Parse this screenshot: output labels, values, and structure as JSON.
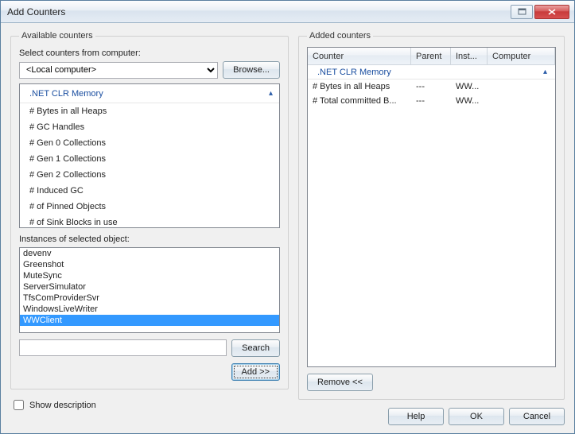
{
  "window": {
    "title": "Add Counters"
  },
  "available": {
    "legend": "Available counters",
    "select_label": "Select counters from computer:",
    "computer_value": "<Local computer>",
    "browse_label": "Browse...",
    "group_name": ".NET CLR Memory",
    "counters": [
      "# Bytes in all Heaps",
      "# GC Handles",
      "# Gen 0 Collections",
      "# Gen 1 Collections",
      "# Gen 2 Collections",
      "# Induced GC",
      "# of Pinned Objects",
      "# of Sink Blocks in use"
    ],
    "instances_label": "Instances of selected object:",
    "instances": [
      "devenv",
      "Greenshot",
      "MuteSync",
      "ServerSimulator",
      "TfsComProviderSvr",
      "WindowsLiveWriter",
      "WWClient"
    ],
    "search_label": "Search",
    "add_label": "Add >>",
    "show_desc_label": "Show description"
  },
  "added": {
    "legend": "Added counters",
    "cols": {
      "c1": "Counter",
      "c2": "Parent",
      "c3": "Inst...",
      "c4": "Computer"
    },
    "group_name": ".NET CLR Memory",
    "rows": [
      {
        "counter": "# Bytes in all Heaps",
        "parent": "---",
        "inst": "WW...",
        "computer": ""
      },
      {
        "counter": "# Total committed B...",
        "parent": "---",
        "inst": "WW...",
        "computer": ""
      }
    ],
    "remove_label": "Remove <<"
  },
  "footer": {
    "help": "Help",
    "ok": "OK",
    "cancel": "Cancel"
  }
}
